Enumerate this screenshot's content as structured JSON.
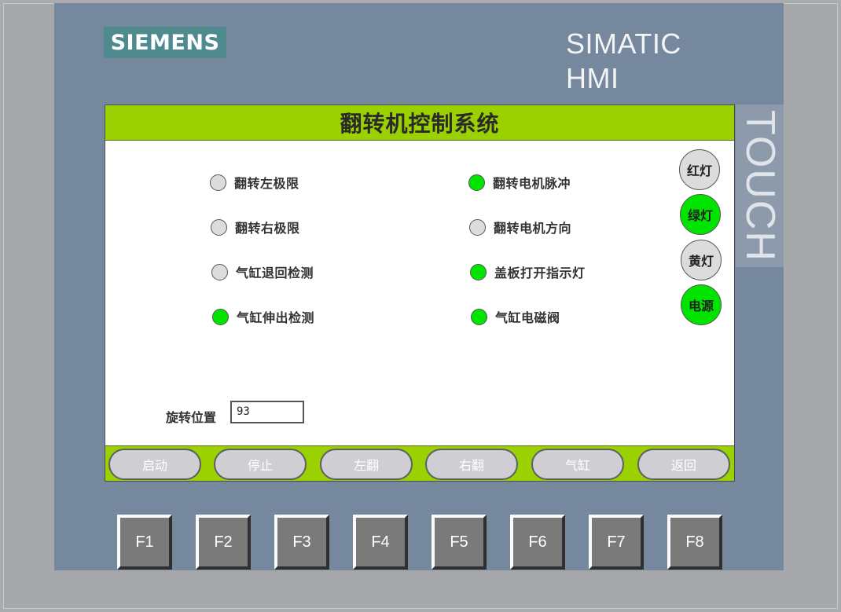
{
  "brand": {
    "logo": "SIEMENS",
    "product": "SIMATIC HMI",
    "touch_label": "TOUCH"
  },
  "screen": {
    "title": "翻转机控制系统",
    "indicators_left": [
      {
        "label": "翻转左极限",
        "state": "off"
      },
      {
        "label": "翻转右极限",
        "state": "off"
      },
      {
        "label": "气缸退回检测",
        "state": "off"
      },
      {
        "label": "气缸伸出检测",
        "state": "on"
      }
    ],
    "indicators_right": [
      {
        "label": "翻转电机脉冲",
        "state": "on"
      },
      {
        "label": "翻转电机方向",
        "state": "off"
      },
      {
        "label": "盖板打开指示灯",
        "state": "on"
      },
      {
        "label": "气缸电磁阀",
        "state": "on"
      }
    ],
    "lamps": [
      {
        "label": "红灯",
        "state": "off"
      },
      {
        "label": "绿灯",
        "state": "on"
      },
      {
        "label": "黄灯",
        "state": "off"
      },
      {
        "label": "电源",
        "state": "on"
      }
    ],
    "position": {
      "label": "旋转位置",
      "value": "93"
    },
    "buttons": [
      "启动",
      "停止",
      "左翻",
      "右翻",
      "气缸",
      "返回"
    ]
  },
  "function_keys": [
    "F1",
    "F2",
    "F3",
    "F4",
    "F5",
    "F6",
    "F7",
    "F8"
  ],
  "colors": {
    "title_bar": "#9bd100",
    "led_on": "#00e400",
    "led_off": "#dcdcdc",
    "bezel": "#76889d",
    "logo_bg": "#4f8a8f"
  }
}
